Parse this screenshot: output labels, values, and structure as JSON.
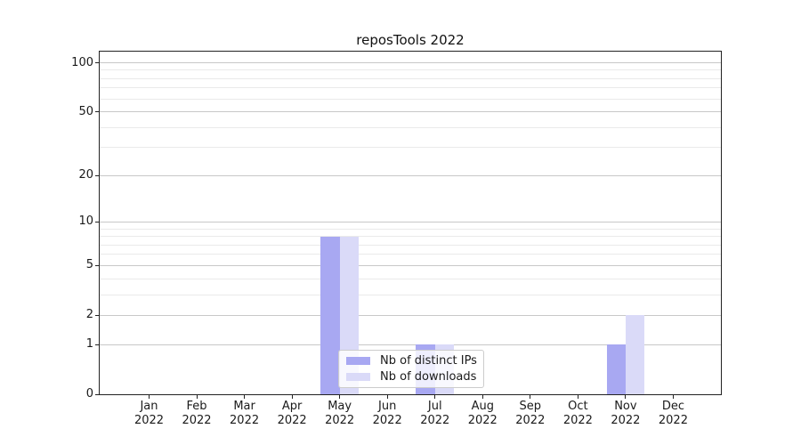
{
  "chart_data": {
    "type": "bar",
    "title": "reposTools 2022",
    "categories": [
      "Jan",
      "Feb",
      "Mar",
      "Apr",
      "May",
      "Jun",
      "Jul",
      "Aug",
      "Sep",
      "Oct",
      "Nov",
      "Dec"
    ],
    "x_year": "2022",
    "series": [
      {
        "name": "Nb of distinct IPs",
        "color": "#a8a8f2",
        "values": [
          0,
          0,
          0,
          0,
          8,
          0,
          1,
          0,
          0,
          0,
          1,
          0
        ]
      },
      {
        "name": "Nb of downloads",
        "color": "#dadaf8",
        "values": [
          0,
          0,
          0,
          0,
          8,
          0,
          1,
          0,
          0,
          0,
          2,
          0
        ]
      }
    ],
    "y_axis": {
      "scale": "log1p",
      "ticks": [
        0,
        1,
        2,
        5,
        10,
        20,
        50,
        100
      ],
      "minor_ticks": [
        3,
        4,
        6,
        7,
        8,
        9,
        30,
        40,
        60,
        70,
        80,
        90
      ],
      "ylim": [
        0,
        100
      ]
    },
    "xlabel": "",
    "ylabel": "",
    "grid": true,
    "legend_position": "lower center",
    "colors": {
      "grid_major": "#c8c8c8",
      "grid_minor": "#eaeaea",
      "frame": "#222222",
      "text": "#1a1a1a",
      "background": "#ffffff"
    }
  }
}
